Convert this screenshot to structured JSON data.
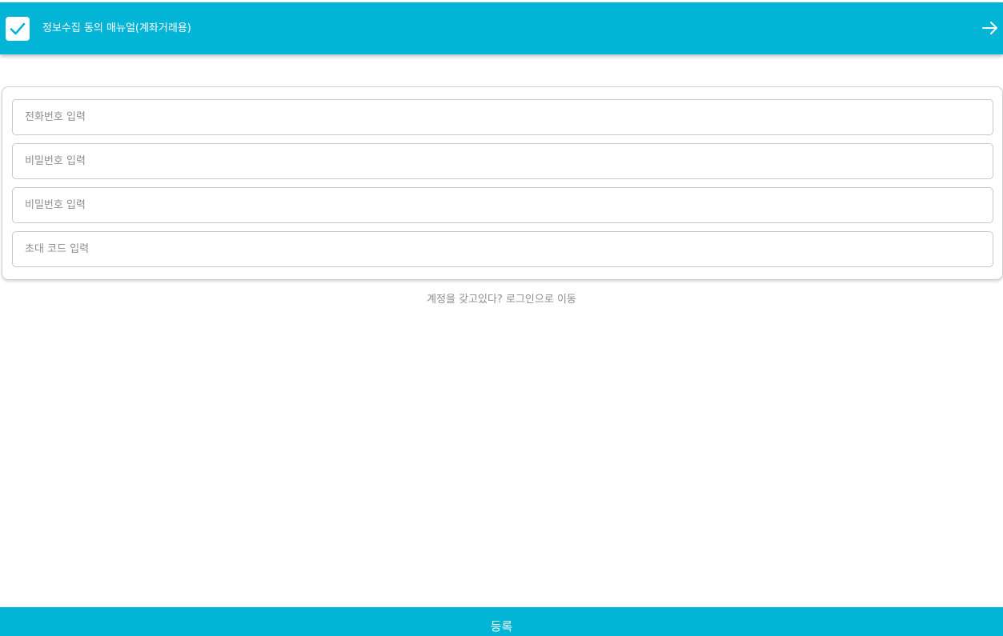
{
  "header": {
    "consent_checked": true,
    "consent_label": "정보수집 동의 매뉴얼(계좌거래용)",
    "checkbox_icon": "check-icon",
    "next_icon": "arrow-right-icon",
    "accent_color": "#02b4d6"
  },
  "form": {
    "phone": {
      "placeholder": "전화번호 입력",
      "value": ""
    },
    "password": {
      "placeholder": "비밀번호 입력",
      "value": ""
    },
    "password_confirm": {
      "placeholder": "비밀번호 입력",
      "value": ""
    },
    "invite_code": {
      "placeholder": "초대 코드 입력",
      "value": ""
    }
  },
  "login_link": "계정을 갖고있다? 로그인으로 이동",
  "register_button": "등록"
}
